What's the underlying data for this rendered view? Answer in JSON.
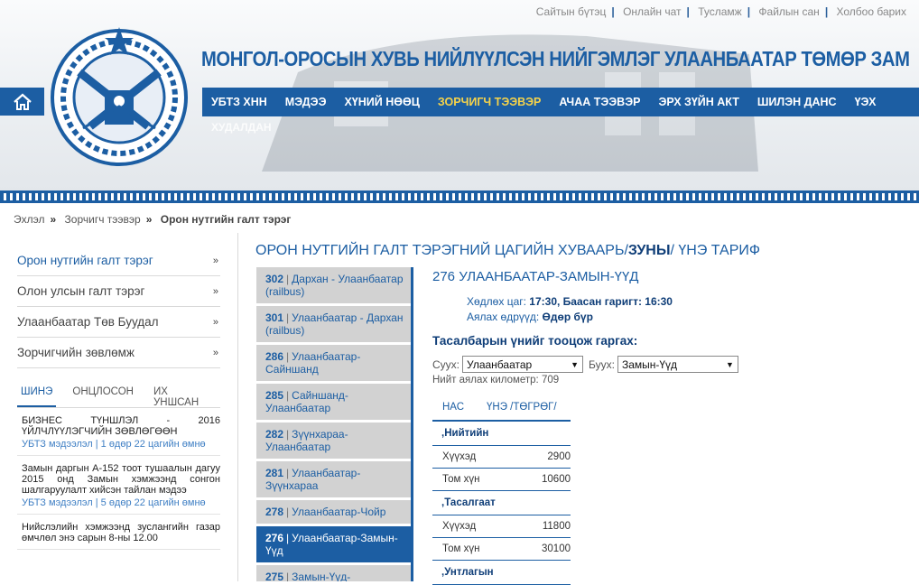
{
  "top_links": [
    "Сайтын бүтэц",
    "Онлайн чат",
    "Тусламж",
    "Файлын сан",
    "Холбоо барих"
  ],
  "site_title": "МОНГОЛ-ОРОСЫН ХУВЬ НИЙЛҮҮЛСЭН НИЙГЭМЛЭГ УЛААНБААТАР ТӨМӨР ЗАМ",
  "nav": [
    "УБТЗ ХНН",
    "МЭДЭЭ",
    "ХҮНИЙ НӨӨЦ",
    "ЗОРЧИГЧ ТЭЭВЭР",
    "АЧАА ТЭЭВЭР",
    "ЭРХ ЗҮЙН АКТ",
    "ШИЛЭН ДАНС",
    "ҮЭХ"
  ],
  "nav_active_index": 3,
  "nav_overflow": "ХУДАЛДАН",
  "breadcrumb": {
    "home": "Эхлэл",
    "section": "Зорчигч тээвэр",
    "current": "Орон нутгийн галт тэрэг"
  },
  "sidebar": {
    "links": [
      "Орон нутгийн галт тэрэг",
      "Олон улсын галт тэрэг",
      "Улаанбаатар Төв Буудал",
      "Зорчигчийн зөвлөмж"
    ],
    "tabs": [
      "ШИНЭ",
      "ОНЦЛОСОН",
      "ИХ УНШСАН"
    ],
    "news": [
      {
        "title": "БИЗНЕС ТҮНШЛЭЛ - 2016 ҮЙЛЧЛҮҮЛЭГЧИЙН ЗӨВЛӨГӨӨН",
        "meta": "УБТЗ мэдээлэл | 1 өдөр 22 цагийн өмнө"
      },
      {
        "title": "Замын даргын А-152 тоот тушаалын дагуу 2015 онд Замын хэмжээнд сонгон шалгаруулалт хийсэн тайлан мэдээ",
        "meta": "УБТЗ мэдээлэл | 5 өдөр 22 цагийн өмнө"
      },
      {
        "title": "Нийслэлийн хэмжээнд зуслангийн газар өмчлөл энэ сарын 8-ны 12.00",
        "meta": ""
      }
    ]
  },
  "heading": {
    "prefix": "ОРОН НУТГИЙН ГАЛТ ТЭРЭГНИЙ ЦАГИЙН ХУВААРЬ/",
    "bold": "ЗУНЫ",
    "suffix": "/ ҮНЭ ТАРИФ"
  },
  "trains": [
    {
      "num": "302",
      "route": "Дархан - Улаанбаатар (railbus)"
    },
    {
      "num": "301",
      "route": "Улаанбаатар - Дархан (railbus)"
    },
    {
      "num": "286",
      "route": "Улаанбаатар-Сайншанд"
    },
    {
      "num": "285",
      "route": "Сайншанд-Улаанбаатар"
    },
    {
      "num": "282",
      "route": "Зүүнхараа-Улаанбаатар"
    },
    {
      "num": "281",
      "route": "Улаанбаатар-Зүүнхараа"
    },
    {
      "num": "278",
      "route": "Улаанбаатар-Чойр"
    },
    {
      "num": "276",
      "route": "Улаанбаатар-Замын-Үүд"
    },
    {
      "num": "275",
      "route": "Замын-Үүд-Улаанбаатар"
    }
  ],
  "active_train_index": 7,
  "detail": {
    "title": "276 УЛААНБААТАР-ЗАМЫН-ҮҮД",
    "dep_label": "Хөдлөх цаг:",
    "dep_value": "17:30, Баасан гаригт: 16:30",
    "days_label": "Аялах өдрүүд:",
    "days_value": "Өдөр бүр",
    "calc_title": "Тасалбарын үнийг тооцож гаргах:",
    "from_label": "Суух:",
    "from_value": "Улаанбаатар",
    "to_label": "Буух:",
    "to_value": "Замын-Үүд",
    "km_text": "Нийт аялах километр: 709",
    "table_headers": [
      "НАС",
      "ҮНЭ /ТӨГРӨГ/"
    ],
    "sections": [
      {
        "name": ",Нийтийн",
        "rows": [
          {
            "label": "Хүүхэд",
            "price": "2900"
          },
          {
            "label": "Том хүн",
            "price": "10600"
          }
        ]
      },
      {
        "name": ",Тасалгаат",
        "rows": [
          {
            "label": "Хүүхэд",
            "price": "11800"
          },
          {
            "label": "Том хүн",
            "price": "30100"
          }
        ]
      },
      {
        "name": ",Унтлагын",
        "rows": []
      }
    ]
  },
  "colors": {
    "brand": "#1c5ea3",
    "nav_active": "#f6d34a"
  }
}
